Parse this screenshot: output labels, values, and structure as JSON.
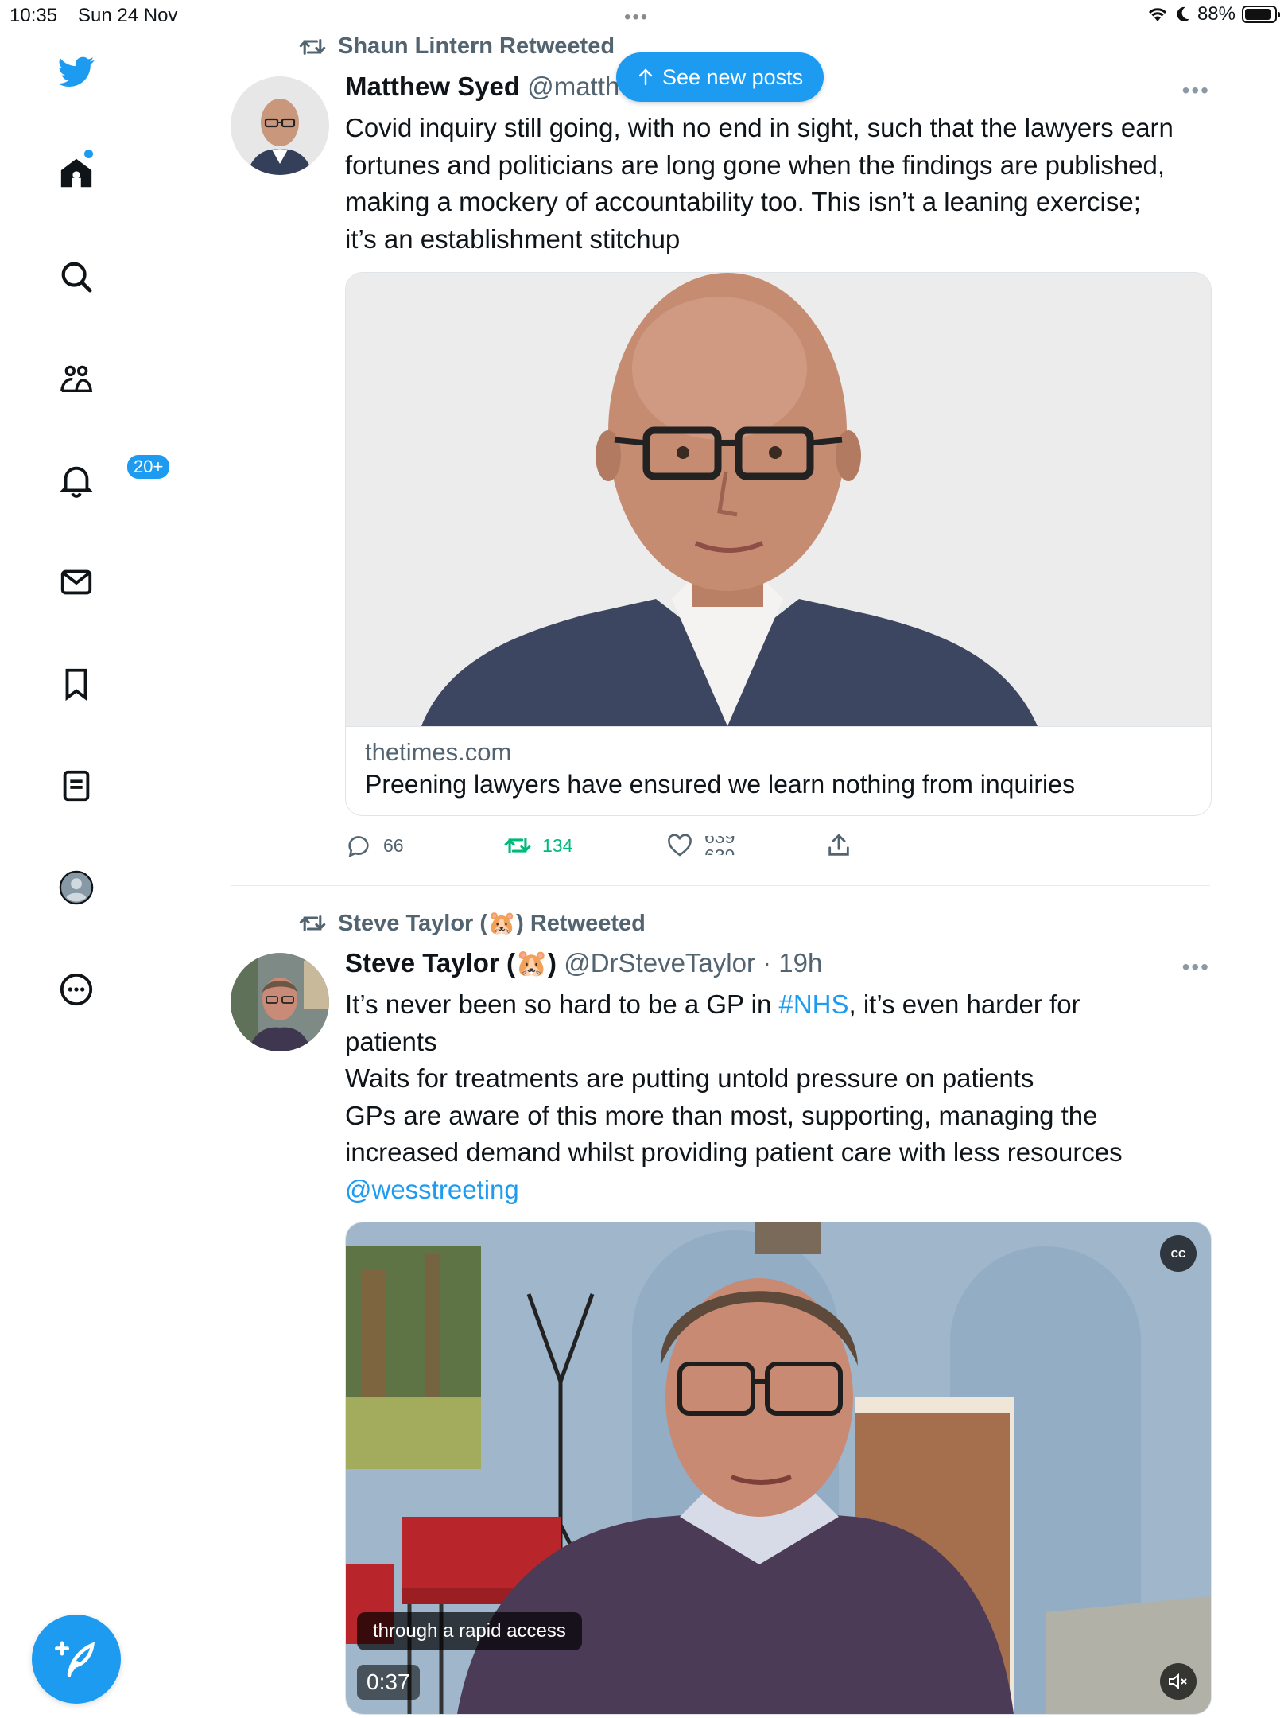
{
  "status_bar": {
    "time": "10:35",
    "date": "Sun 24 Nov",
    "battery": "88%",
    "battery_level": 0.88
  },
  "sidebar": {
    "items": [
      {
        "name": "twitter-logo"
      },
      {
        "name": "home"
      },
      {
        "name": "explore"
      },
      {
        "name": "communities"
      },
      {
        "name": "notifications",
        "badge": "20+"
      },
      {
        "name": "messages"
      },
      {
        "name": "bookmarks"
      },
      {
        "name": "lists"
      },
      {
        "name": "profile"
      },
      {
        "name": "more"
      }
    ],
    "compose": "compose"
  },
  "new_posts_label": "See new posts",
  "tweets": [
    {
      "retweeted_by": "Shaun Lintern Retweeted",
      "name": "Matthew Syed",
      "handle": "@matth",
      "body_lines": [
        "Covid inquiry still going, with no end in sight, such that the lawyers earn",
        "fortunes and politicians are long gone when the findings are published,",
        "making a mockery of accountability too. This isn’t a leaning exercise;",
        "it’s an establishment stitchup"
      ],
      "card": {
        "domain": "thetimes.com",
        "title": "Preening lawyers have ensured we learn nothing from inquiries"
      },
      "actions": {
        "replies": "66",
        "retweets": "134",
        "likes": "639"
      }
    },
    {
      "retweeted_by": "Steve Taylor (🐹) Retweeted",
      "name": "Steve Taylor (🐹)",
      "handle": "@DrSteveTaylor",
      "time": "· 19h",
      "body_lines": [
        {
          "pre": "It’s never been so hard to be a GP in ",
          "tag": "#NHS",
          "post": ", it’s even harder for"
        },
        "patients",
        "Waits for treatments are putting untold pressure on patients",
        "GPs are aware of this more than most, supporting, managing the",
        "increased demand whilst providing patient care with less resources"
      ],
      "mention": "@wesstreeting",
      "video": {
        "caption": "through a rapid access",
        "duration": "0:37",
        "cc_label": "CC"
      }
    }
  ]
}
